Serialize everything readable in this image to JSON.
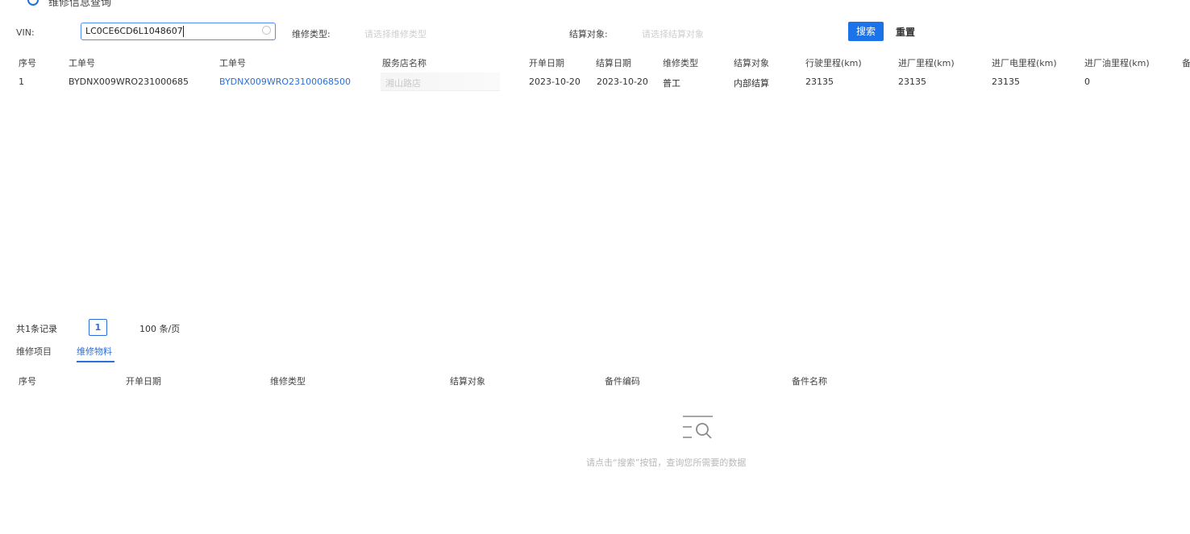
{
  "page": {
    "title": "维修信息查询"
  },
  "filters": {
    "vin_label": "VIN:",
    "vin_value": "LC0CE6CD6L1048607",
    "repair_type_label": "维修类型:",
    "repair_type_placeholder": "请选择维修类型",
    "settle_target_label": "结算对象:",
    "settle_target_placeholder": "请选择结算对象",
    "search_label": "搜索",
    "reset_label": "重置"
  },
  "orders_table": {
    "columns": [
      "序号",
      "工单号",
      "工单号",
      "服务店名称",
      "开单日期",
      "结算日期",
      "维修类型",
      "结算对象",
      "行驶里程(km)",
      "进厂里程(km)",
      "进厂电里程(km)",
      "进厂油里程(km)",
      "备"
    ],
    "rows": [
      [
        "1",
        "BYDNX009WRO231000685",
        "BYDNX009WRO23100068500",
        "湘山路店",
        "2023-10-20",
        "2023-10-20",
        "普工",
        "内部结算",
        "23135",
        "23135",
        "23135",
        "0"
      ]
    ]
  },
  "pagination": {
    "total": "共1条记录",
    "page": "1",
    "page_size": "100 条/页"
  },
  "detail_tabs": [
    {
      "label": "维修项目"
    },
    {
      "label": "维修物料"
    }
  ],
  "materials_table": {
    "columns": [
      "序号",
      "开单日期",
      "维修类型",
      "结算对象",
      "备件编码",
      "备件名称"
    ]
  },
  "empty_state": {
    "icon": "empty-search-icon",
    "text": "请点击“搜索”按钮，查询您所需要的数据"
  },
  "colors": {
    "primary": "#1a73e8",
    "link": "#2a6fdb"
  }
}
